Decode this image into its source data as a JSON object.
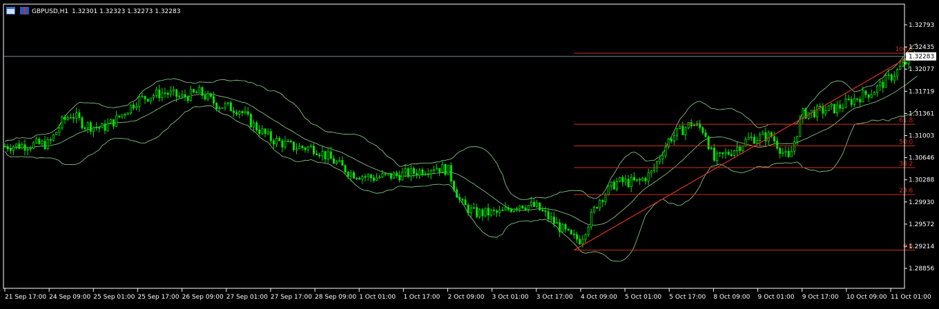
{
  "header": {
    "symbol": "GBPUSD,H1",
    "ohlc": "1.32301 1.32323 1.32273 1.32283"
  },
  "chart_data": {
    "type": "candlestick",
    "symbol": "GBPUSD",
    "timeframe": "H1",
    "price_axis": {
      "labels": [
        "1.32793",
        "1.32435",
        "1.32077",
        "1.31719",
        "1.31361",
        "1.31003",
        "1.30646",
        "1.30288",
        "1.29930",
        "1.29572",
        "1.29214",
        "1.28856"
      ],
      "current_price": "1.32283",
      "range": [
        1.28637,
        1.3309
      ]
    },
    "time_axis": {
      "labels": [
        "21 Sep 17:00",
        "24 Sep 09:00",
        "25 Sep 01:00",
        "25 Sep 17:00",
        "26 Sep 09:00",
        "27 Sep 01:00",
        "27 Sep 17:00",
        "28 Sep 09:00",
        "1 Oct 01:00",
        "1 Oct 17:00",
        "2 Oct 09:00",
        "3 Oct 01:00",
        "3 Oct 17:00",
        "4 Oct 09:00",
        "5 Oct 01:00",
        "5 Oct 17:00",
        "8 Oct 09:00",
        "9 Oct 01:00",
        "9 Oct 17:00",
        "10 Oct 09:00",
        "11 Oct 01:00"
      ]
    },
    "price_path": [
      {
        "t": 0,
        "p": 1.3083
      },
      {
        "t": 1,
        "p": 1.3087
      },
      {
        "t": 1.3,
        "p": 1.3123
      },
      {
        "t": 1.5,
        "p": 1.3135
      },
      {
        "t": 1.8,
        "p": 1.3118
      },
      {
        "t": 2.2,
        "p": 1.3112
      },
      {
        "t": 2.5,
        "p": 1.3125
      },
      {
        "t": 3.0,
        "p": 1.3158
      },
      {
        "t": 3.3,
        "p": 1.3165
      },
      {
        "t": 3.6,
        "p": 1.317
      },
      {
        "t": 4.0,
        "p": 1.3162
      },
      {
        "t": 4.4,
        "p": 1.317
      },
      {
        "t": 4.8,
        "p": 1.315
      },
      {
        "t": 5.3,
        "p": 1.3142
      },
      {
        "t": 5.6,
        "p": 1.3118
      },
      {
        "t": 6.0,
        "p": 1.3095
      },
      {
        "t": 6.5,
        "p": 1.3082
      },
      {
        "t": 7.0,
        "p": 1.308
      },
      {
        "t": 7.5,
        "p": 1.3055
      },
      {
        "t": 7.8,
        "p": 1.304
      },
      {
        "t": 8.3,
        "p": 1.3032
      },
      {
        "t": 8.7,
        "p": 1.3035
      },
      {
        "t": 9.2,
        "p": 1.304
      },
      {
        "t": 9.7,
        "p": 1.305
      },
      {
        "t": 10.0,
        "p": 1.3045
      },
      {
        "t": 10.3,
        "p": 1.299
      },
      {
        "t": 10.6,
        "p": 1.2975
      },
      {
        "t": 11.2,
        "p": 1.2975
      },
      {
        "t": 11.6,
        "p": 1.299
      },
      {
        "t": 12.0,
        "p": 1.2985
      },
      {
        "t": 12.4,
        "p": 1.296
      },
      {
        "t": 12.8,
        "p": 1.2935
      },
      {
        "t": 13.0,
        "p": 1.2932
      },
      {
        "t": 13.4,
        "p": 1.2995
      },
      {
        "t": 13.8,
        "p": 1.3025
      },
      {
        "t": 14.3,
        "p": 1.3025
      },
      {
        "t": 14.6,
        "p": 1.304
      },
      {
        "t": 15.0,
        "p": 1.3095
      },
      {
        "t": 15.5,
        "p": 1.312
      },
      {
        "t": 15.8,
        "p": 1.3108
      },
      {
        "t": 16.0,
        "p": 1.306
      },
      {
        "t": 16.4,
        "p": 1.3075
      },
      {
        "t": 16.8,
        "p": 1.3095
      },
      {
        "t": 17.3,
        "p": 1.31
      },
      {
        "t": 17.7,
        "p": 1.306
      },
      {
        "t": 18.0,
        "p": 1.3135
      },
      {
        "t": 18.4,
        "p": 1.314
      },
      {
        "t": 18.8,
        "p": 1.3145
      },
      {
        "t": 19.2,
        "p": 1.316
      },
      {
        "t": 19.6,
        "p": 1.3172
      },
      {
        "t": 20.0,
        "p": 1.3195
      },
      {
        "t": 20.4,
        "p": 1.3222
      },
      {
        "t": 20.6,
        "p": 1.323
      }
    ],
    "fibonacci": {
      "levels": [
        {
          "label": "100.0",
          "value": 1.32334
        },
        {
          "label": "61.8",
          "value": 1.31186
        },
        {
          "label": "50.0",
          "value": 1.30836
        },
        {
          "label": "38.2",
          "value": 1.30485
        },
        {
          "label": "23.6",
          "value": 1.30049
        },
        {
          "label": "0.0",
          "value": 1.29151
        }
      ],
      "trendline": {
        "from": {
          "t": 12.85,
          "p": 1.29151
        },
        "to": {
          "t": 20.55,
          "p": 1.32334
        }
      },
      "color": "#d0301c"
    },
    "indicators": [
      "Bollinger Bands"
    ],
    "colors": {
      "background": "#000000",
      "candles": "#00e600",
      "bands": "#8fd88f",
      "axis": "#ffffff",
      "fib": "#d0301c",
      "bid_line": "#778899"
    },
    "grid": false
  }
}
